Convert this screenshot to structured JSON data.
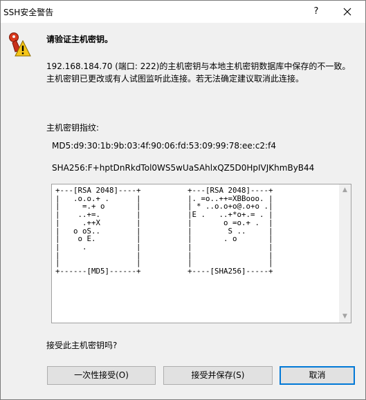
{
  "window": {
    "title": "SSH安全警告",
    "help_glyph": "?",
    "close_glyph": "close"
  },
  "heading": "请验证主机密钥。",
  "message": "192.168.184.70 (端口: 222)的主机密钥与本地主机密钥数据库中保存的不一致。主机密钥已更改或有人试图监听此连接。若无法确定建议取消此连接。",
  "fingerprint": {
    "label": "主机密钥指纹:",
    "md5": "MD5:d9:30:1b:9b:03:4f:90:06:fd:53:09:99:78:ee:c2:f4",
    "sha256": "SHA256:F+hptDnRkdTol0WS5wUaSAhlxQZ5D0HpIVJKhmByB44"
  },
  "randomart": {
    "md5": "+---[RSA 2048]----+\n|   .o.o.+ .      |\n|     =.+ o       |\n|    ..+=.        |\n|     .++X        |\n|   o oS..        |\n|    o E.         |\n|     .           |\n|                 |\n|                 |\n+------[MD5]------+",
    "sha256": "+---[RSA 2048]----+\n|. =o..++=XBBooo. |\n| * ..o.o+o@.o+o .|\n|E .   ..+*o+.= . |\n|       o =o.+ .  |\n|        S ..     |\n|       . o       |\n|                 |\n|                 |\n|                 |\n+----[SHA256]-----+"
  },
  "question": "接受此主机密钥吗?",
  "buttons": {
    "accept_once": "一次性接受(O)",
    "accept_save": "接受并保存(S)",
    "cancel": "取消"
  },
  "icons": {
    "warning": "key-warning-icon",
    "close": "close-icon"
  }
}
